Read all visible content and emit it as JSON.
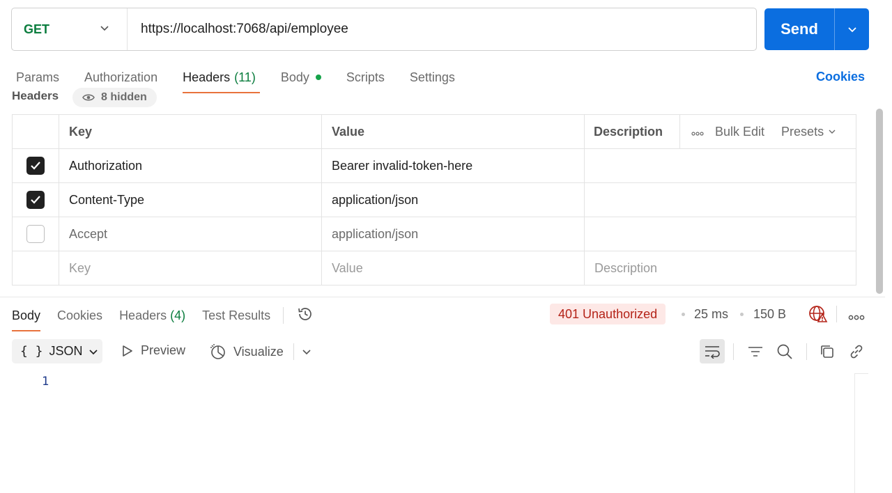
{
  "request": {
    "method": "GET",
    "url": "https://localhost:7068/api/employee",
    "send_label": "Send"
  },
  "request_tabs": [
    {
      "label": "Params"
    },
    {
      "label": "Authorization"
    },
    {
      "label": "Headers",
      "count": "(11)",
      "active": true
    },
    {
      "label": "Body",
      "has_dot": true
    },
    {
      "label": "Scripts"
    },
    {
      "label": "Settings"
    }
  ],
  "cookies_label": "Cookies",
  "headers_section": {
    "title": "Headers",
    "hidden_label": "8 hidden"
  },
  "table": {
    "columns": {
      "key": "Key",
      "value": "Value",
      "description": "Description"
    },
    "tools": {
      "bulk_edit": "Bulk Edit",
      "presets": "Presets"
    },
    "rows": [
      {
        "checked": true,
        "key": "Authorization",
        "value": "Bearer invalid-token-here",
        "description": ""
      },
      {
        "checked": true,
        "key": "Content-Type",
        "value": "application/json",
        "description": ""
      },
      {
        "checked": false,
        "key": "Accept",
        "value": "application/json",
        "description": ""
      }
    ],
    "placeholders": {
      "key": "Key",
      "value": "Value",
      "description": "Description"
    }
  },
  "response_tabs": [
    {
      "label": "Body",
      "active": true
    },
    {
      "label": "Cookies"
    },
    {
      "label": "Headers",
      "count": "(4)"
    },
    {
      "label": "Test Results"
    }
  ],
  "response": {
    "status": "401 Unauthorized",
    "time": "25 ms",
    "size": "150 B",
    "format": "JSON",
    "format_braces": "{ }",
    "preview_label": "Preview",
    "visualize_label": "Visualize",
    "line_numbers": [
      "1"
    ]
  },
  "colors": {
    "accent": "#0b6ee0",
    "method_green": "#0b7d3e",
    "tab_underline": "#e8723c",
    "error_text": "#b42318",
    "error_bg": "#fde8e6"
  }
}
